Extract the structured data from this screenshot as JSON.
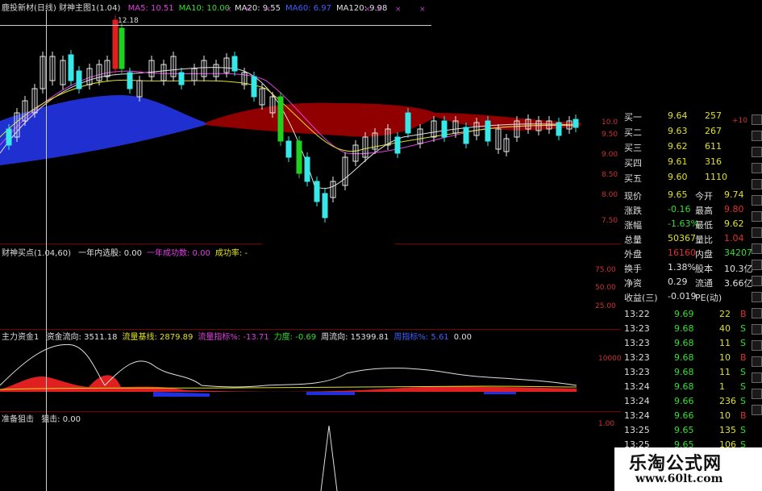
{
  "main": {
    "title": "鹿投新材(日线) 财神主图1(1.04)",
    "indicators": [
      {
        "label": "MA5: 10.51",
        "color": "#e040e0"
      },
      {
        "label": "MA10: 10.00",
        "color": "#30e030"
      },
      {
        "label": "MA20: 9.55",
        "color": "#e0e0e0"
      },
      {
        "label": "MA60: 6.97",
        "color": "#4060ff"
      },
      {
        "label": "MA120: 9.98",
        "color": "#e0e0e0"
      }
    ],
    "peak_label": "12.18",
    "axis": [
      "10.0",
      "9.50",
      "9.00",
      "8.50",
      "8.00",
      "7.50"
    ],
    "top_right": "+10"
  },
  "buy": {
    "title": "财神买点(1.04,60)",
    "items": [
      {
        "label": "一年内选股: 0.00",
        "color": "#e0e0e0"
      },
      {
        "label": "一年成功数: 0.00",
        "color": "#e040e0"
      },
      {
        "label": "成功率: -",
        "color": "#e0e020"
      }
    ],
    "axis": [
      "75.00",
      "50.00",
      "25.00"
    ]
  },
  "fund": {
    "title": "主力资金1",
    "items": [
      {
        "label": "资金流向: 3511.18",
        "color": "#e0e0e0"
      },
      {
        "label": "流量基线: 2879.89",
        "color": "#e0e020"
      },
      {
        "label": "流量指标%: -13.71",
        "color": "#e040e0"
      },
      {
        "label": "力度: -0.69",
        "color": "#30e030"
      },
      {
        "label": "周流向: 15399.81",
        "color": "#e0e0e0"
      },
      {
        "label": "周指标%: 5.61",
        "color": "#4060ff"
      },
      {
        "label": "0.00",
        "color": "#e0e0e0"
      }
    ],
    "axis": [
      "10000"
    ]
  },
  "attack": {
    "title": "准备狙击",
    "items": [
      {
        "label": "狙击: 0.00",
        "color": "#e0e0e0"
      }
    ],
    "axis": [
      "1.00"
    ]
  },
  "quotes": {
    "bids": [
      {
        "name": "买一",
        "price": "9.64",
        "vol": "257"
      },
      {
        "name": "买二",
        "price": "9.63",
        "vol": "267"
      },
      {
        "name": "买三",
        "price": "9.62",
        "vol": "611"
      },
      {
        "name": "买四",
        "price": "9.61",
        "vol": "316"
      },
      {
        "name": "买五",
        "price": "9.60",
        "vol": "1110"
      }
    ],
    "stats": [
      {
        "k1": "现价",
        "v1": "9.65",
        "k2": "今开",
        "v2": "9.74",
        "c1": "#e0e020",
        "c2": "#e0e020"
      },
      {
        "k1": "涨跌",
        "v1": "-0.16",
        "k2": "最高",
        "v2": "9.80",
        "c1": "#30e030",
        "c2": "#e03030"
      },
      {
        "k1": "涨幅",
        "v1": "-1.63%",
        "k2": "最低",
        "v2": "9.62",
        "c1": "#30e030",
        "c2": "#e0e020"
      },
      {
        "k1": "总量",
        "v1": "50367",
        "k2": "量比",
        "v2": "1.04",
        "c1": "#e0e020",
        "c2": "#e03030"
      },
      {
        "k1": "外盘",
        "v1": "16160",
        "k2": "内盘",
        "v2": "34207",
        "c1": "#e03030",
        "c2": "#30e030"
      },
      {
        "k1": "换手",
        "v1": "1.38%",
        "k2": "股本",
        "v2": "10.3亿",
        "c1": "#e0e0e0",
        "c2": "#e0e0e0"
      },
      {
        "k1": "净资",
        "v1": "0.29",
        "k2": "流通",
        "v2": "3.66亿",
        "c1": "#e0e0e0",
        "c2": "#e0e0e0"
      },
      {
        "k1": "收益(三)",
        "v1": "-0.019",
        "k2": "PE(动)",
        "v2": "",
        "c1": "#e0e0e0",
        "c2": "#e0e0e0"
      }
    ],
    "ticks": [
      {
        "time": "13:22",
        "price": "9.69",
        "vol": "22",
        "side": "B"
      },
      {
        "time": "13:23",
        "price": "9.68",
        "vol": "40",
        "side": "S"
      },
      {
        "time": "13:23",
        "price": "9.68",
        "vol": "11",
        "side": "S"
      },
      {
        "time": "13:23",
        "price": "9.68",
        "vol": "10",
        "side": "B"
      },
      {
        "time": "13:23",
        "price": "9.68",
        "vol": "11",
        "side": "S"
      },
      {
        "time": "13:24",
        "price": "9.68",
        "vol": "1",
        "side": "S"
      },
      {
        "time": "13:24",
        "price": "9.66",
        "vol": "236",
        "side": "S"
      },
      {
        "time": "13:24",
        "price": "9.66",
        "vol": "10",
        "side": "B"
      },
      {
        "time": "13:25",
        "price": "9.65",
        "vol": "135",
        "side": "S"
      },
      {
        "time": "13:25",
        "price": "9.65",
        "vol": "106",
        "side": "S"
      }
    ]
  },
  "watermark": {
    "title": "乐淘公式网",
    "url": "www.60lt.com"
  }
}
